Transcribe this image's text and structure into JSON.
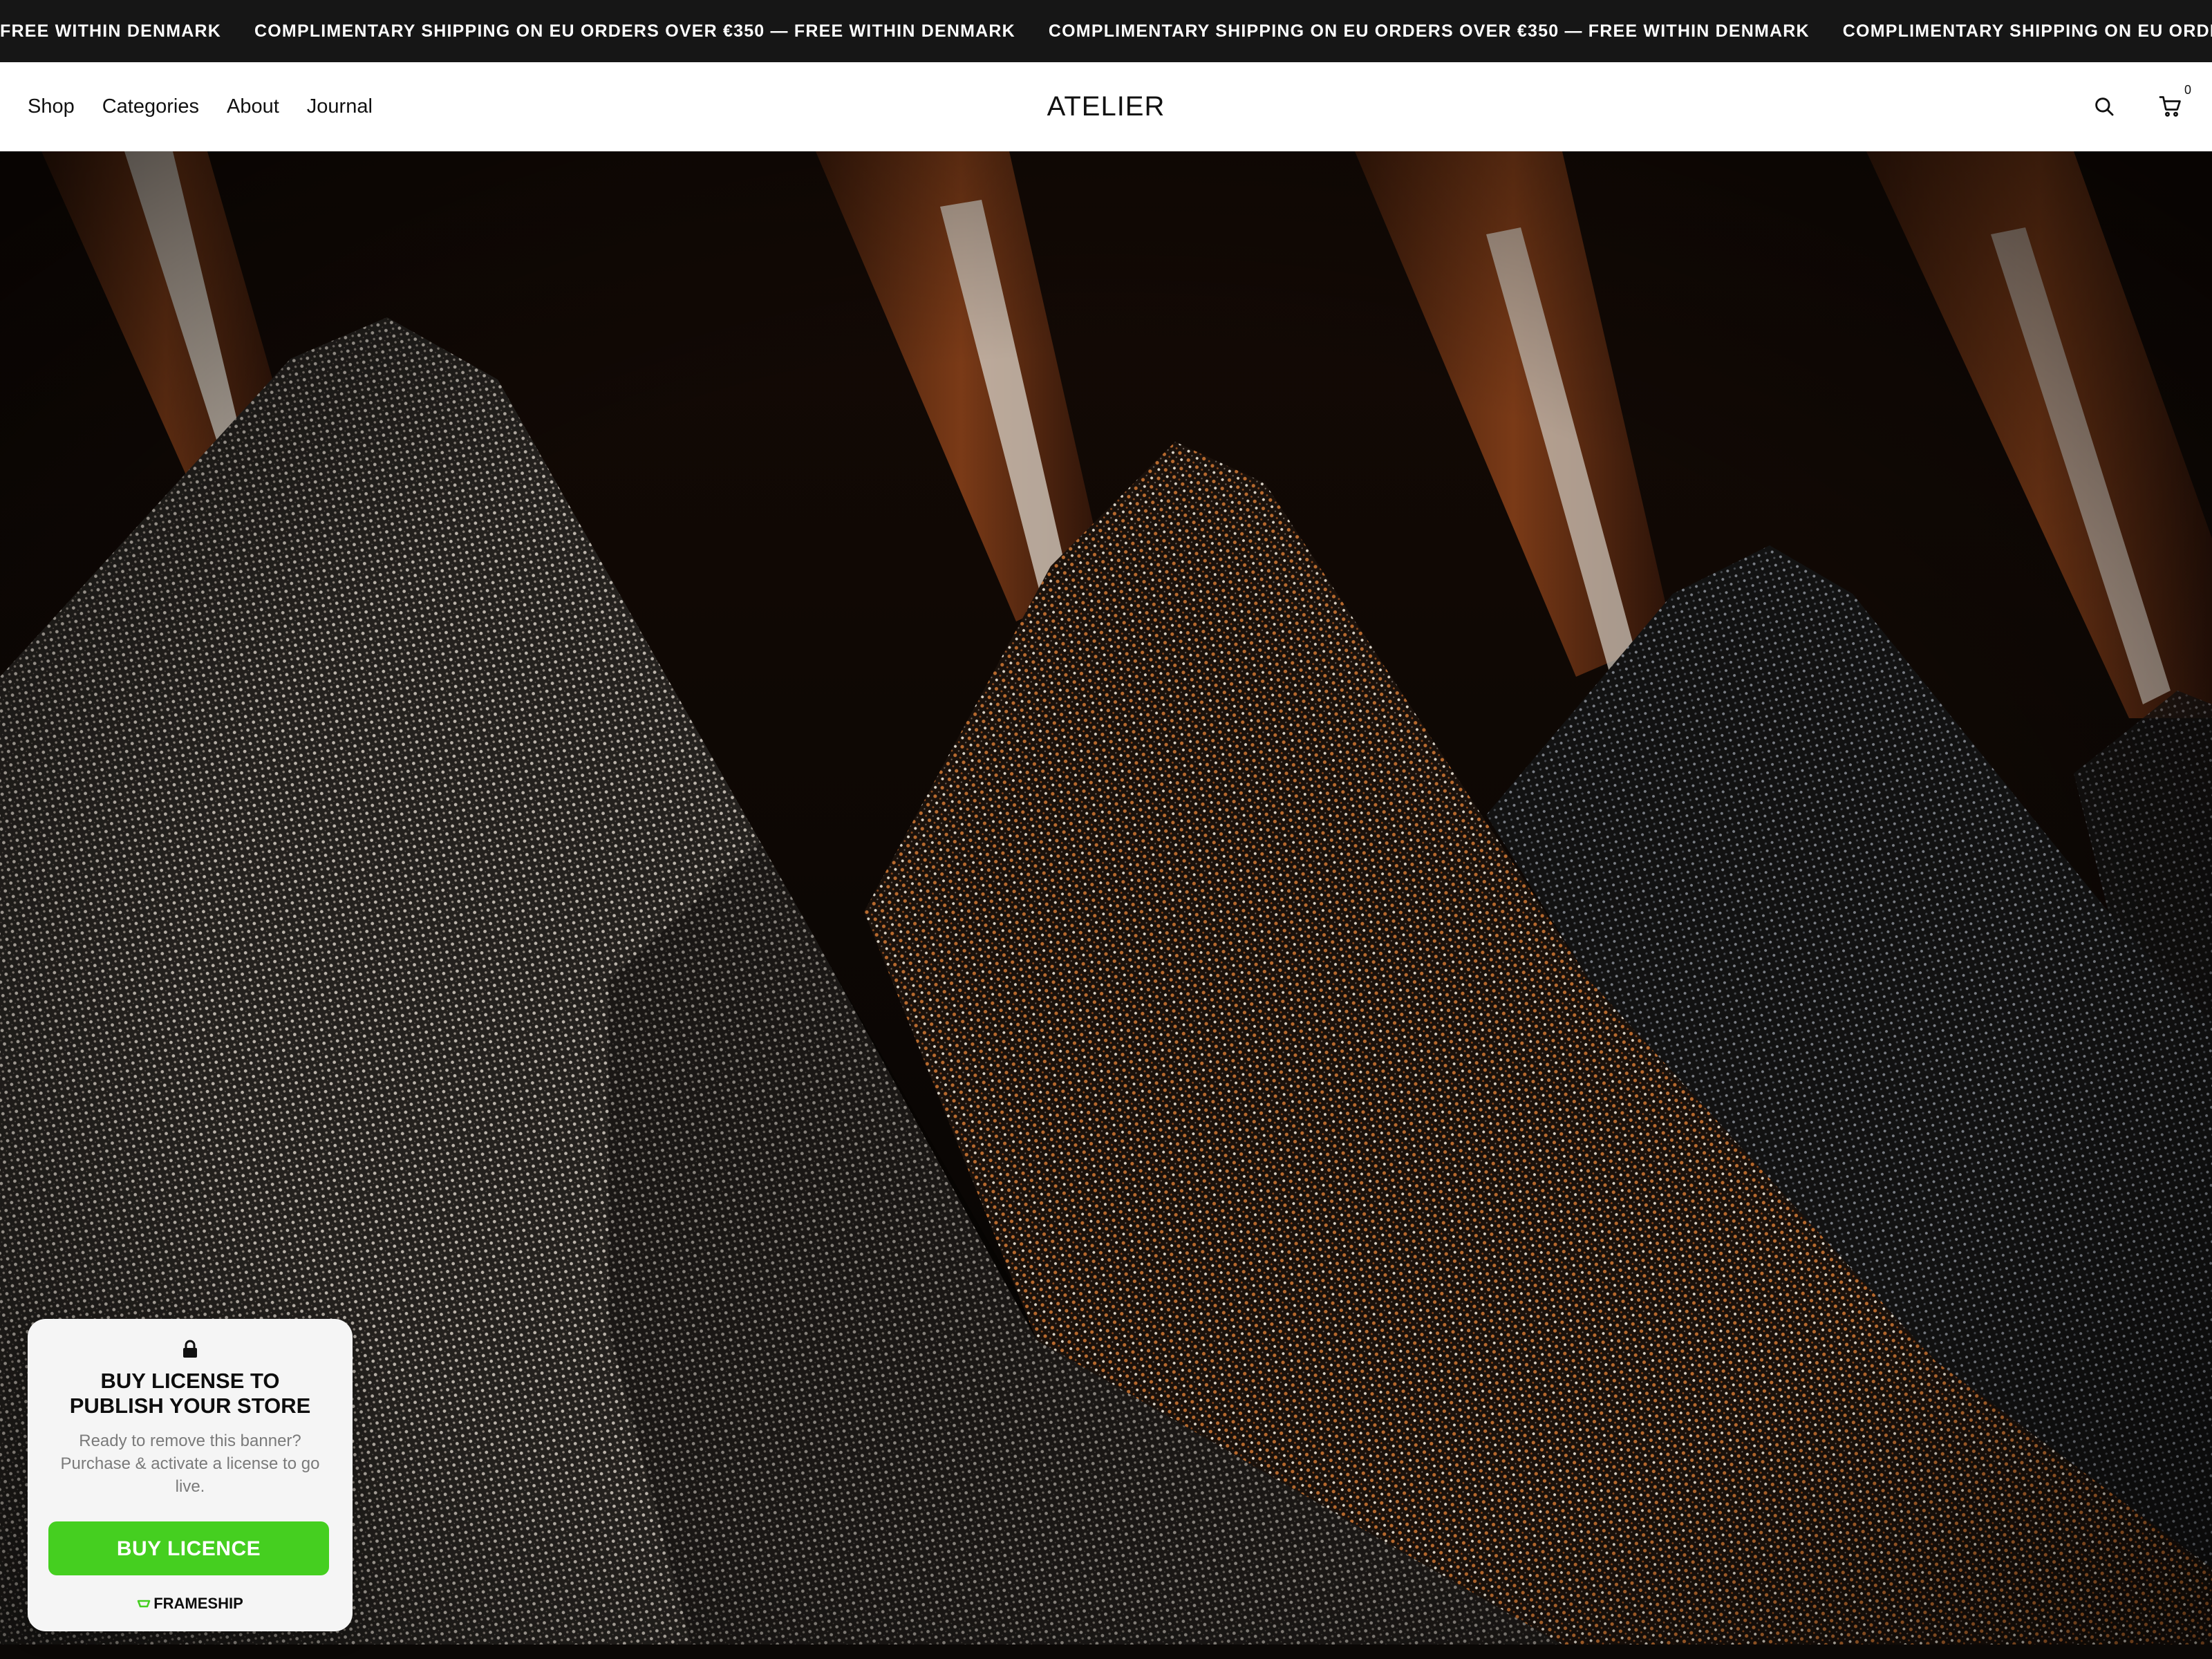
{
  "announcement": {
    "items": [
      "FREE WITHIN DENMARK",
      "COMPLIMENTARY SHIPPING ON EU ORDERS OVER €350 — FREE WITHIN DENMARK",
      "COMPLIMENTARY SHIPPING ON EU ORDERS OVER €350 — FREE WITHIN DENMARK",
      "COMPLIMENTARY SHIPPING ON EU ORDERS OVER €350 — FR"
    ]
  },
  "header": {
    "nav": [
      "Shop",
      "Categories",
      "About",
      "Journal"
    ],
    "brand": "ATELIER",
    "icons": {
      "search": "search-icon",
      "cart": "cart-icon"
    },
    "cart_count": "0"
  },
  "licence_banner": {
    "icon": "lock-icon",
    "title": "BUY LICENSE TO PUBLISH YOUR STORE",
    "body": "Ready to remove this banner? Purchase & activate a license to go live.",
    "button": "BUY LICENCE",
    "footer_brand": "FRAMESHIP",
    "button_color": "#45cf20"
  },
  "colors": {
    "announcement_bg": "#161616",
    "header_bg": "#ffffff",
    "accent_green": "#45cf20"
  }
}
